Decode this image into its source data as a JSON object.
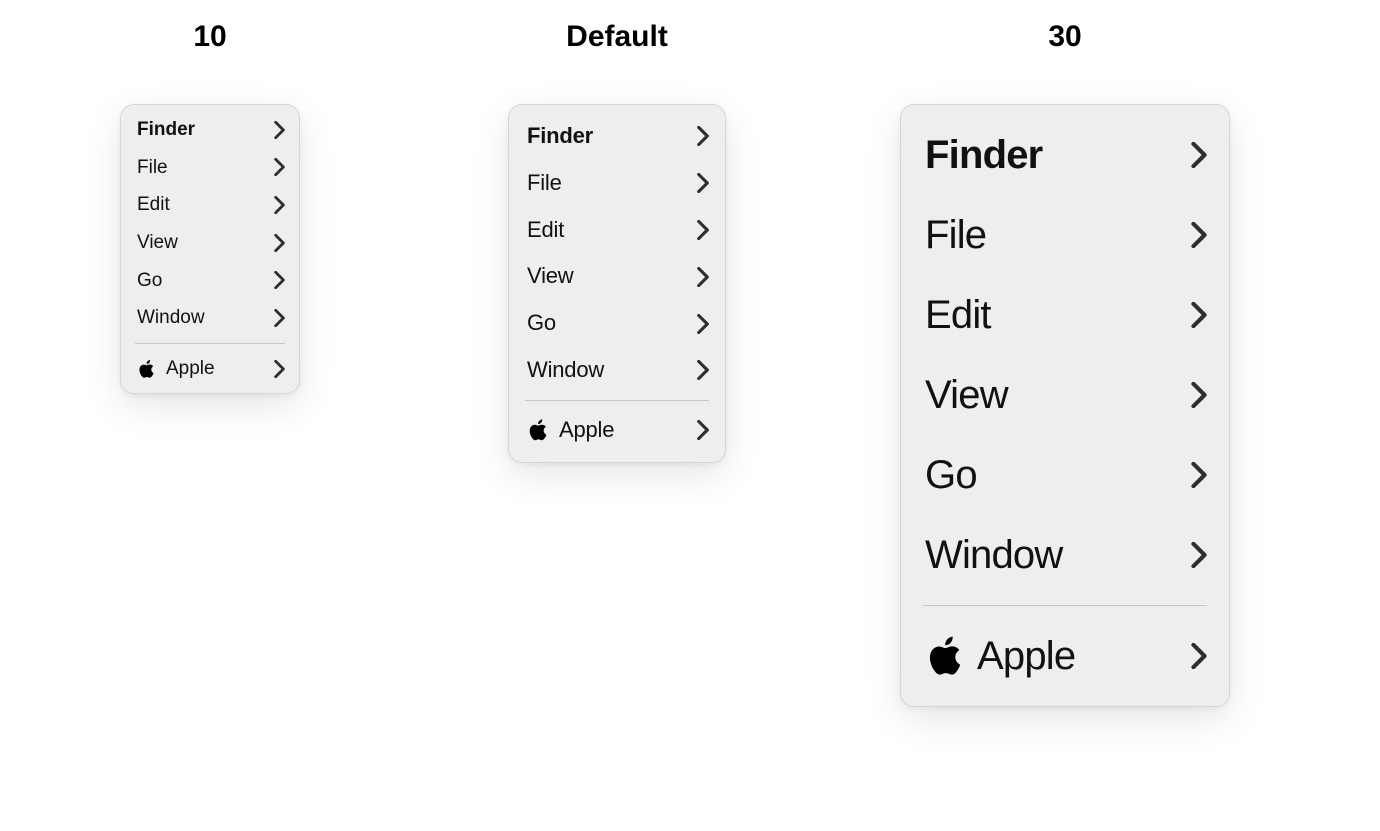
{
  "panels": [
    {
      "key": "10",
      "heading": "10",
      "sizeClass": "sz-10"
    },
    {
      "key": "default",
      "heading": "Default",
      "sizeClass": "sz-default"
    },
    {
      "key": "30",
      "heading": "30",
      "sizeClass": "sz-30"
    }
  ],
  "menu": {
    "items": [
      {
        "label": "Finder",
        "bold": true
      },
      {
        "label": "File"
      },
      {
        "label": "Edit"
      },
      {
        "label": "View"
      },
      {
        "label": "Go"
      },
      {
        "label": "Window"
      }
    ],
    "separator": true,
    "footer": {
      "label": "Apple",
      "icon": "apple-icon"
    }
  }
}
